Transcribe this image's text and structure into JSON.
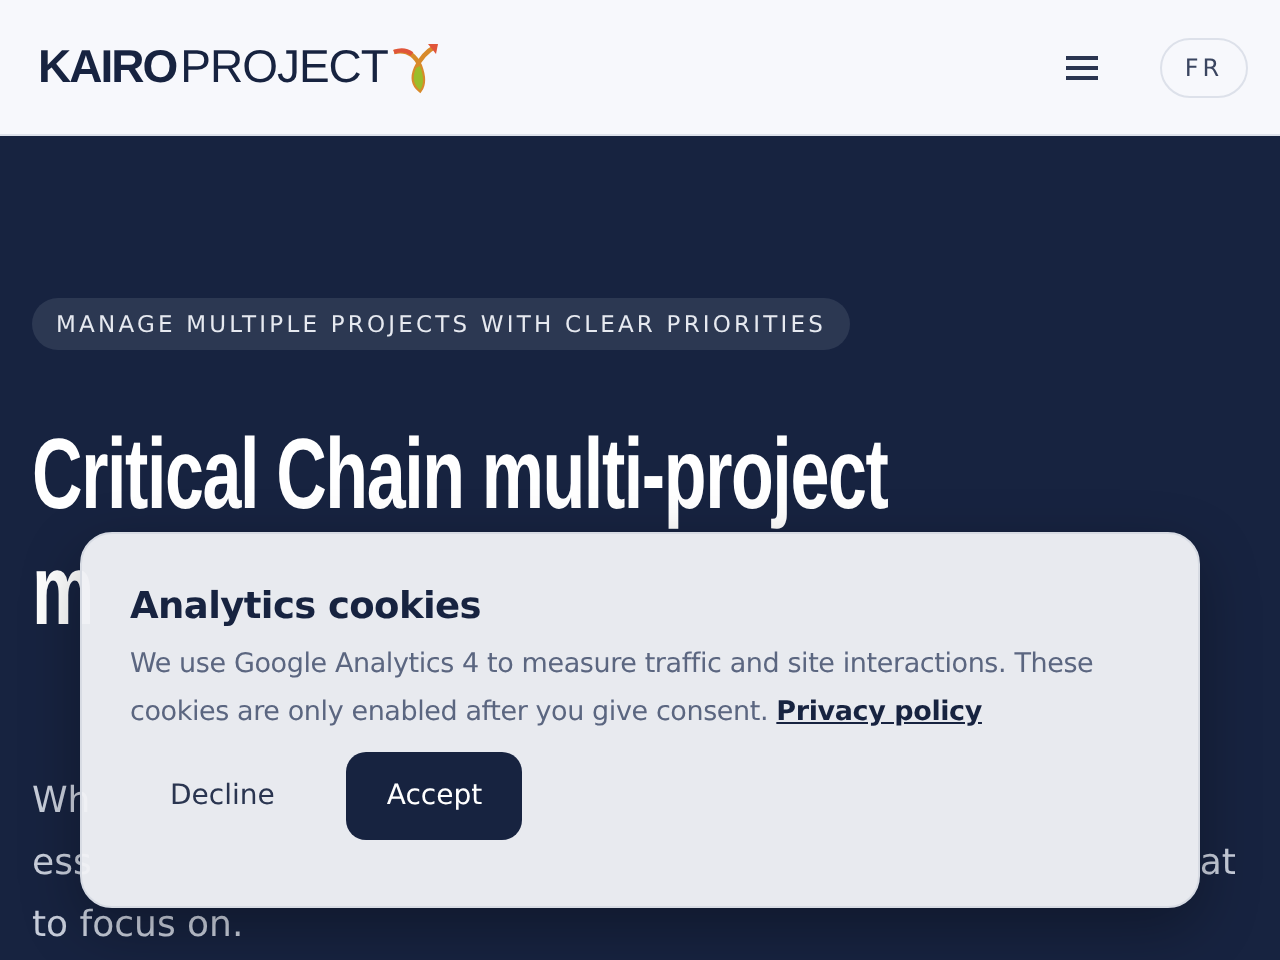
{
  "header": {
    "logo": {
      "bold": "KAIRO",
      "light": "PROJECT"
    },
    "language_button": "FR"
  },
  "hero": {
    "badge": "MANAGE MULTIPLE PROJECTS WITH CLEAR PRIORITIES",
    "title_lines": [
      "Critical Chain multi-project",
      "m"
    ],
    "paragraph_fragments": [
      {
        "left": "Wh"
      },
      {
        "left": "ess",
        "right": "at"
      },
      {
        "left": "to focus on."
      }
    ]
  },
  "cookie_dialog": {
    "title": "Analytics cookies",
    "text": "We use Google Analytics 4 to measure traffic and site interactions. These cookies are only enabled after you give consent.",
    "link": "Privacy policy",
    "buttons": [
      {
        "label": "Decline",
        "kind": "secondary"
      },
      {
        "label": "Accept",
        "kind": "primary"
      }
    ]
  }
}
